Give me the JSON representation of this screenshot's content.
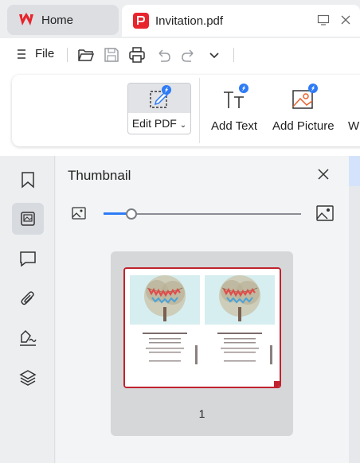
{
  "tabs": {
    "home_label": "Home",
    "doc_label": "Invitation.pdf"
  },
  "menu": {
    "file_label": "File"
  },
  "ribbon": {
    "edit_pdf_label": "Edit PDF",
    "add_text_label": "Add Text",
    "add_picture_label": "Add Picture",
    "partial_label": "Wi"
  },
  "thumbnail_panel": {
    "title": "Thumbnail",
    "zoom_level": 0.14,
    "page_number": "1"
  },
  "colors": {
    "accent": "#2e7bf6",
    "brand_red": "#e8242c",
    "selection": "#c0232d"
  },
  "icons": [
    "app-logo-icon",
    "pdf-icon",
    "window-icon",
    "close-icon",
    "menu-icon",
    "open-folder-icon",
    "save-icon",
    "print-icon",
    "undo-icon",
    "redo-icon",
    "chevron-down-icon",
    "edit-pdf-icon",
    "add-text-icon",
    "add-picture-icon",
    "bookmark-icon",
    "thumbnail-icon",
    "comment-icon",
    "attachment-icon",
    "signature-icon",
    "layers-icon",
    "image-small-icon",
    "image-large-icon"
  ]
}
